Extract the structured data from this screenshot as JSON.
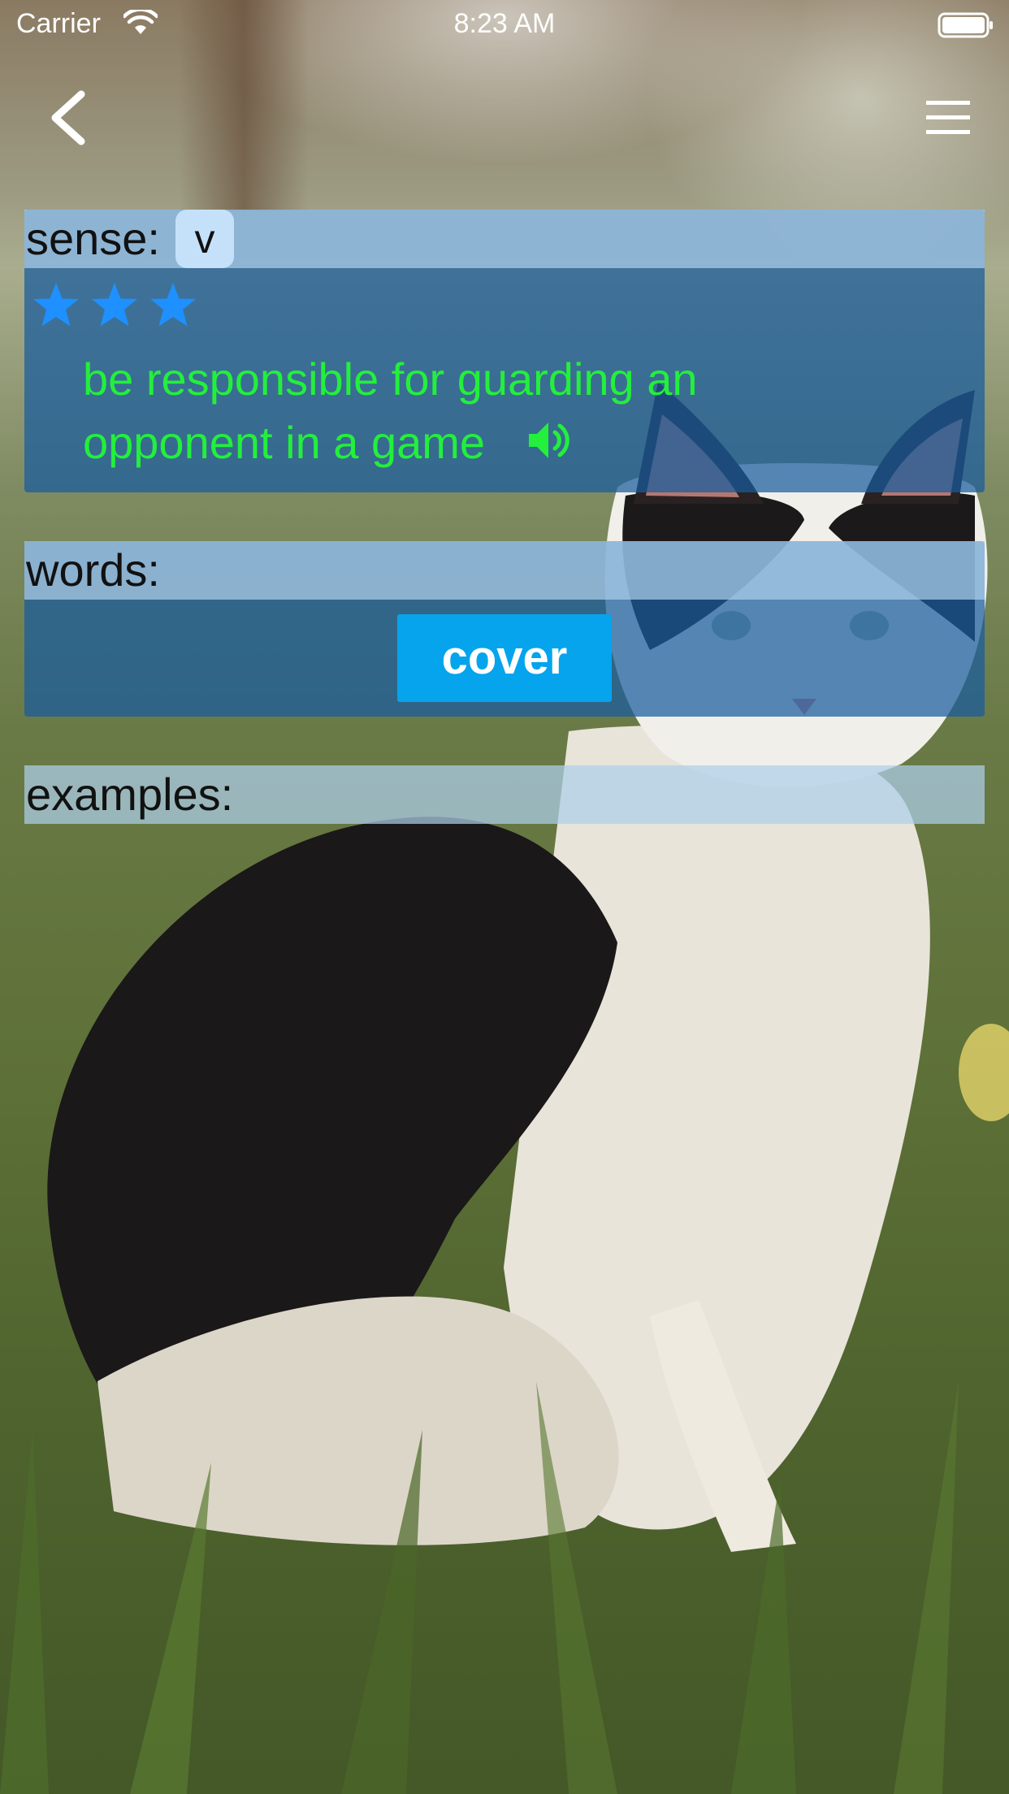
{
  "status_bar": {
    "carrier": "Carrier",
    "time": "8:23 AM"
  },
  "nav": {
    "back_icon": "chevron-left-icon",
    "menu_icon": "hamburger-menu-icon"
  },
  "sense": {
    "label": "sense:",
    "part_of_speech": "v",
    "rating": 3,
    "definition": "be responsible for guarding an opponent in a game"
  },
  "words": {
    "label": "words:",
    "items": [
      "cover"
    ]
  },
  "examples": {
    "label": "examples:"
  },
  "colors": {
    "panel": "#185c9e",
    "panel_header": "#adceea",
    "definition_text": "#23ef3c",
    "star": "#1e90ff",
    "word_chip": "#05a4ed"
  }
}
